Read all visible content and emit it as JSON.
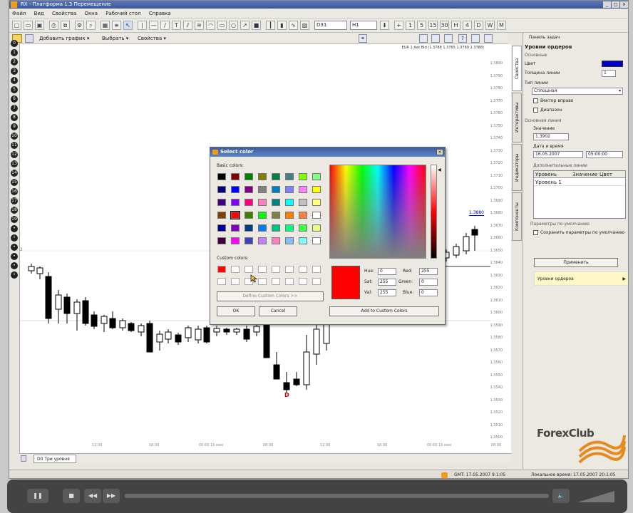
{
  "window": {
    "title": "RX - Платформа 1.3 Перемещение"
  },
  "menu": [
    "Файл",
    "Вид",
    "Свойства",
    "Окна",
    "Рабочий стол",
    "Справка"
  ],
  "toolbar": {
    "timeframe": "D31",
    "period": "H1"
  },
  "toolbar2": {
    "add_chart": "Добавить график ▾",
    "select": "Выбрать ▾",
    "properties": "Свойства ▾"
  },
  "chart": {
    "info": "EUR 1 Ask Bid (1.3788 1.3765 1.3789 1.3788)",
    "price_labels": [
      "1.3800",
      "1.3790",
      "1.3780",
      "1.3770",
      "1.3760",
      "1.3750",
      "1.3740",
      "1.3730",
      "1.3720",
      "1.3710",
      "1.3700",
      "1.3690",
      "1.3680",
      "1.3670",
      "1.3660",
      "1.3650",
      "1.3640",
      "1.3630",
      "1.3620",
      "1.3610",
      "1.3600",
      "1.3590",
      "1.3580",
      "1.3570",
      "1.3560",
      "1.3550",
      "1.3540",
      "1.3530",
      "1.3520",
      "1.3510",
      "1.3500"
    ],
    "level_tag": "1.3880",
    "time_labels": [
      "12:00",
      "16:00",
      "00:00\n15 мая",
      "08:00",
      "12:00",
      "16:00",
      "00:00\n15 мая",
      "08:00"
    ],
    "marker": "D",
    "level_number": "2"
  },
  "bottom_tab": "D0 Три уровня",
  "status": {
    "gmt": "GMT: 17.05.2007 9:1:05",
    "local": "Локальное время: 17.05.2007 20:1:05"
  },
  "side_tabs": [
    "Свойства",
    "Интерактивы",
    "Индикаторы",
    "Компоненты"
  ],
  "panel": {
    "header": "Панель задач",
    "section_title": "Уровни ордеров",
    "group_main": "Основные",
    "color_label": "Цвет",
    "color_value": "#0000cc",
    "thickness_label": "Толщина линии",
    "thickness_value": "1",
    "line_type_label": "Тип линии",
    "line_type_value": "Сплошная",
    "checkbox_right": "Вектор вправо",
    "checkbox_range": "Диапазон",
    "group_base": "Основная линия",
    "value_label": "Значение",
    "value_value": "1.3902",
    "date_label": "Дата и время",
    "date_value": "16.05.2007",
    "time_value": "05:00:00",
    "extra_label": "Дополнительные линии",
    "table_headers": [
      "Уровень",
      "Значение",
      "Цвет"
    ],
    "table_row": [
      "Уровень 1",
      "",
      ""
    ],
    "defaults_label": "Параметры по умолчанию",
    "save_defaults": "Сохранить параметры по умолчанию",
    "apply": "Применить",
    "levels_item": "Уровни ордеров"
  },
  "logo": {
    "text": "ForexClub"
  },
  "dialog": {
    "title": "Select color",
    "basic_label": "Basic colors:",
    "basic_colors": [
      "#000000",
      "#800000",
      "#008000",
      "#808000",
      "#008040",
      "#408080",
      "#80ff00",
      "#80ff80",
      "#000080",
      "#0000ff",
      "#800080",
      "#808080",
      "#0080c0",
      "#8080ff",
      "#ff80ff",
      "#ffff00",
      "#400080",
      "#8000ff",
      "#ff0080",
      "#ff80c0",
      "#008080",
      "#00ffff",
      "#c0c0c0",
      "#ffff80",
      "#804000",
      "#ff0000",
      "#408000",
      "#00ff00",
      "#808040",
      "#ff8000",
      "#ff8040",
      "#ffffff",
      "#0000a0",
      "#8000c0",
      "#004080",
      "#0080ff",
      "#00c080",
      "#00ff80",
      "#40ff40",
      "#e0ff80",
      "#400040",
      "#ff00ff",
      "#4040c0",
      "#c080ff",
      "#ff80c0",
      "#80c0ff",
      "#80ffff",
      "#ffffff"
    ],
    "custom_label": "Custom colors:",
    "custom_colors": [
      "#ff0000"
    ],
    "define_button": "Define Custom Colors >>",
    "ok": "OK",
    "cancel": "Cancel",
    "hue_label": "Hue:",
    "hue": "0",
    "sat_label": "Sat:",
    "sat": "255",
    "val_label": "Val:",
    "val": "255",
    "red_label": "Red:",
    "red": "255",
    "green_label": "Green:",
    "green": "0",
    "blue_label": "Blue:",
    "blue": "0",
    "add_button": "Add to Custom Colors",
    "preview_color": "#ff0000"
  },
  "player": {
    "pause": "❚❚",
    "stop": "■",
    "prev": "◀◀",
    "next": "▶▶",
    "volume": "🔈"
  }
}
